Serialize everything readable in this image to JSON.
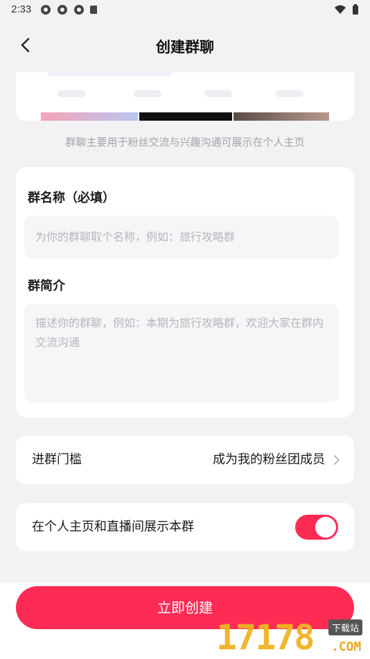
{
  "status_bar": {
    "time": "2:33"
  },
  "header": {
    "title": "创建群聊"
  },
  "preview": {
    "hint": "群聊主要用于粉丝交流与兴趣沟通可展示在个人主页"
  },
  "form": {
    "name_label": "群名称（必填）",
    "name_placeholder": "为你的群聊取个名称，例如：旅行攻略群",
    "intro_label": "群简介",
    "intro_placeholder": "描述你的群聊，例如：本期为旅行攻略群，欢迎大家在群内交流沟通"
  },
  "threshold": {
    "label": "进群门槛",
    "value": "成为我的粉丝团成员"
  },
  "display_toggle": {
    "label": "在个人主页和直播间展示本群",
    "on": true
  },
  "actions": {
    "create_label": "立即创建"
  },
  "watermark": {
    "number": "17178",
    "badge": "下载站",
    "suffix": ".COM"
  },
  "colors": {
    "accent": "#fe2c55",
    "background": "#f2f2f4"
  }
}
